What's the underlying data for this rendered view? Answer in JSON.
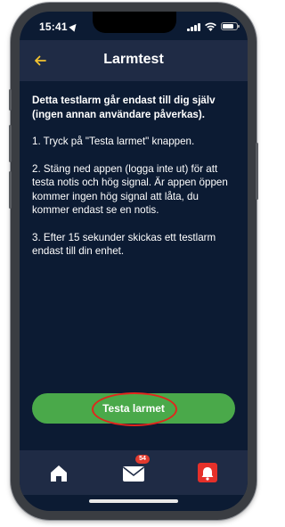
{
  "status_bar": {
    "time": "15:41"
  },
  "header": {
    "title": "Larmtest",
    "back_icon": "arrow-left-icon",
    "back_color": "#f2c330"
  },
  "content": {
    "intro": "Detta testlarm går endast till dig själv (ingen annan användare påverkas).",
    "step1": "1. Tryck på \"Testa larmet\" knappen.",
    "step2": "2. Stäng ned appen (logga inte ut) för att testa notis och hög signal. Är appen öppen kommer ingen hög signal att låta, du kommer endast se en notis.",
    "step3": "3. Efter 15 sekunder skickas ett testlarm endast till din enhet."
  },
  "action": {
    "button_label": "Testa larmet",
    "button_color": "#4aa94a",
    "highlight_color": "#e1261c"
  },
  "tabbar": {
    "items": [
      {
        "name": "home",
        "icon": "home-icon"
      },
      {
        "name": "messages",
        "icon": "mail-icon",
        "badge": "54"
      },
      {
        "name": "alarm",
        "icon": "alarm-bell-icon",
        "color": "#e5302a"
      }
    ]
  }
}
